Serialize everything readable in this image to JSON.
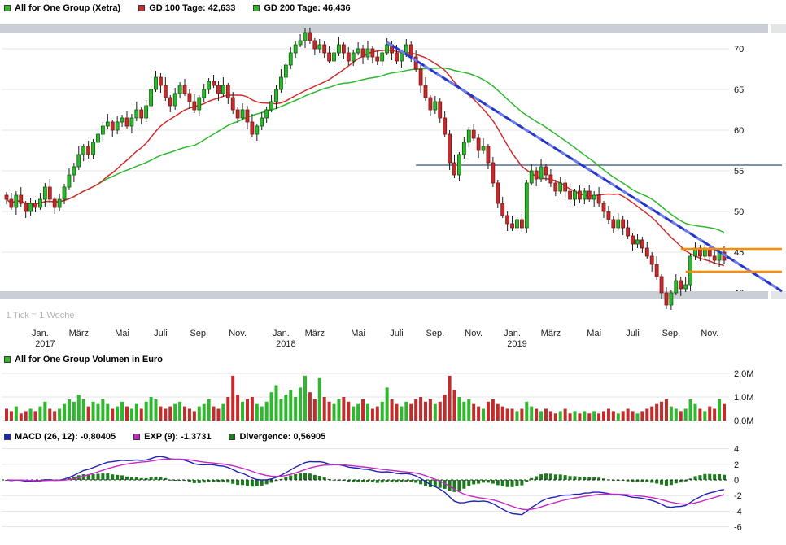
{
  "tick_note": "1 Tick = 1 Woche",
  "legends": {
    "price": [
      {
        "label": "All for One Group (Xetra)",
        "color": "#2DB82D"
      },
      {
        "label": "GD 100 Tage: 42,633",
        "color": "#CE2B2B"
      },
      {
        "label": "GD 200 Tage: 46,436",
        "color": "#2DB82D"
      }
    ],
    "volume": [
      {
        "label": "All for One Group Volumen in Euro",
        "color": "#2DB82D"
      }
    ],
    "macd": [
      {
        "label": "MACD (26, 12): -0,80405",
        "color": "#2023B8"
      },
      {
        "label": "EXP (9): -1,3731",
        "color": "#C628C6"
      },
      {
        "label": "Divergence: 0,56905",
        "color": "#1B7A1B"
      }
    ]
  },
  "chart_data": [
    {
      "type": "candlestick",
      "title": "All for One Group (Xetra)",
      "x_unit": "week",
      "tick_note": "1 Tick = 1 Woche",
      "ylim": [
        37,
        73
      ],
      "yticks": [
        40,
        45,
        50,
        55,
        60,
        65,
        70
      ],
      "xticks": [
        {
          "week": 7,
          "month": "Jan.",
          "year": "2017"
        },
        {
          "week": 15,
          "month": "März"
        },
        {
          "week": 24,
          "month": "Mai"
        },
        {
          "week": 32,
          "month": "Juli"
        },
        {
          "week": 40,
          "month": "Sep."
        },
        {
          "week": 48,
          "month": "Nov."
        },
        {
          "week": 57,
          "month": "Jan.",
          "year": "2018"
        },
        {
          "week": 64,
          "month": "März"
        },
        {
          "week": 73,
          "month": "Mai"
        },
        {
          "week": 81,
          "month": "Juli"
        },
        {
          "week": 89,
          "month": "Sep."
        },
        {
          "week": 97,
          "month": "Nov."
        },
        {
          "week": 105,
          "month": "Jan.",
          "year": "2019"
        },
        {
          "week": 113,
          "month": "März"
        },
        {
          "week": 122,
          "month": "Mai"
        },
        {
          "week": 130,
          "month": "Juli"
        },
        {
          "week": 138,
          "month": "Sep."
        },
        {
          "week": 146,
          "month": "Nov."
        }
      ],
      "colors": {
        "up": "#2DB82D",
        "down": "#C22C2C",
        "wick": "#1a1a1a"
      },
      "overlays": {
        "gd100": {
          "type": "sma",
          "window": 20,
          "color": "#CE2B2B",
          "legend_value": "42,633"
        },
        "gd200": {
          "type": "sma",
          "window": 40,
          "color": "#2DB82D",
          "legend_value": "46,436"
        },
        "trendline": {
          "from": {
            "week": 79,
            "price": 70.8
          },
          "to": {
            "week": 161,
            "price": 40.2
          },
          "color": "#2436C8",
          "dash_color": "#6E80E8"
        },
        "hlines": [
          {
            "price": 55.7,
            "from_week": 85,
            "to_week": 161,
            "color": "#7E92AC",
            "width": 2
          },
          {
            "price": 45.4,
            "from_week": 140,
            "to_week": 161,
            "color": "#FF8A00",
            "width": 2.5
          },
          {
            "price": 42.6,
            "from_week": 141,
            "to_week": 161,
            "color": "#FF8A00",
            "width": 2.5
          }
        ]
      },
      "candles": [
        [
          52.0,
          52.4,
          50.9,
          51.5
        ],
        [
          51.5,
          52.3,
          50.2,
          50.5
        ],
        [
          50.5,
          52.5,
          49.6,
          52.0
        ],
        [
          52.0,
          53.0,
          50.6,
          51.0
        ],
        [
          51.0,
          51.3,
          49.2,
          50.0
        ],
        [
          50.0,
          51.7,
          49.5,
          51.0
        ],
        [
          51.0,
          51.4,
          49.9,
          50.5
        ],
        [
          50.5,
          52.3,
          50.2,
          51.5
        ],
        [
          51.5,
          53.5,
          50.6,
          53.0
        ],
        [
          53.0,
          54.0,
          51.1,
          51.5
        ],
        [
          51.5,
          51.8,
          49.7,
          50.5
        ],
        [
          50.5,
          52.2,
          50.0,
          51.5
        ],
        [
          51.5,
          53.4,
          50.9,
          53.0
        ],
        [
          53.0,
          55.3,
          52.7,
          54.5
        ],
        [
          54.5,
          56.0,
          53.6,
          55.5
        ],
        [
          55.5,
          58.0,
          55.1,
          57.0
        ],
        [
          57.0,
          58.3,
          56.2,
          58.0
        ],
        [
          58.0,
          58.7,
          56.5,
          57.0
        ],
        [
          57.0,
          58.9,
          56.4,
          58.5
        ],
        [
          58.5,
          60.3,
          58.2,
          59.5
        ],
        [
          59.5,
          61.0,
          58.6,
          60.5
        ],
        [
          60.5,
          62.0,
          60.1,
          61.0
        ],
        [
          61.0,
          61.3,
          59.2,
          60.0
        ],
        [
          60.0,
          61.7,
          59.5,
          61.0
        ],
        [
          61.0,
          61.9,
          60.4,
          61.5
        ],
        [
          61.5,
          62.3,
          60.2,
          60.5
        ],
        [
          60.5,
          62.0,
          59.6,
          61.5
        ],
        [
          61.5,
          63.5,
          61.1,
          62.5
        ],
        [
          62.5,
          62.8,
          60.7,
          61.5
        ],
        [
          61.5,
          63.7,
          61.0,
          63.0
        ],
        [
          63.0,
          65.4,
          62.4,
          65.0
        ],
        [
          65.0,
          67.3,
          64.7,
          66.5
        ],
        [
          66.5,
          67.0,
          64.6,
          65.5
        ],
        [
          65.5,
          66.5,
          63.6,
          64.0
        ],
        [
          64.0,
          64.3,
          62.2,
          63.0
        ],
        [
          63.0,
          65.2,
          62.5,
          64.5
        ],
        [
          64.5,
          65.9,
          63.9,
          65.5
        ],
        [
          65.5,
          66.3,
          64.2,
          64.5
        ],
        [
          64.5,
          65.0,
          62.6,
          63.5
        ],
        [
          63.5,
          64.5,
          62.1,
          62.5
        ],
        [
          62.5,
          64.3,
          61.7,
          64.0
        ],
        [
          64.0,
          65.7,
          63.5,
          65.0
        ],
        [
          65.0,
          66.4,
          64.4,
          66.0
        ],
        [
          66.0,
          66.8,
          65.2,
          65.5
        ],
        [
          65.5,
          66.0,
          63.6,
          64.5
        ],
        [
          64.5,
          66.5,
          64.1,
          65.5
        ],
        [
          65.5,
          65.8,
          63.2,
          64.0
        ],
        [
          64.0,
          64.7,
          62.0,
          62.5
        ],
        [
          62.5,
          62.9,
          60.9,
          61.5
        ],
        [
          61.5,
          63.3,
          61.2,
          62.5
        ],
        [
          62.5,
          63.0,
          60.1,
          61.0
        ],
        [
          61.0,
          62.0,
          59.1,
          59.5
        ],
        [
          59.5,
          60.8,
          58.7,
          60.5
        ],
        [
          60.5,
          62.2,
          60.0,
          61.5
        ],
        [
          61.5,
          62.9,
          60.9,
          62.5
        ],
        [
          62.5,
          64.3,
          62.2,
          63.5
        ],
        [
          63.5,
          65.5,
          62.6,
          65.0
        ],
        [
          65.0,
          67.5,
          64.6,
          66.5
        ],
        [
          66.5,
          68.3,
          65.7,
          68.0
        ],
        [
          68.0,
          70.2,
          67.5,
          69.5
        ],
        [
          69.5,
          70.9,
          68.9,
          70.5
        ],
        [
          70.5,
          71.8,
          70.2,
          71.0
        ],
        [
          71.0,
          72.5,
          70.1,
          72.0
        ],
        [
          72.0,
          72.6,
          70.6,
          71.0
        ],
        [
          71.0,
          71.3,
          69.2,
          70.0
        ],
        [
          70.0,
          71.2,
          69.5,
          70.5
        ],
        [
          70.5,
          70.9,
          68.9,
          69.5
        ],
        [
          69.5,
          70.3,
          68.2,
          68.5
        ],
        [
          68.5,
          70.0,
          67.6,
          69.5
        ],
        [
          69.5,
          71.5,
          69.1,
          70.5
        ],
        [
          70.5,
          70.8,
          68.7,
          69.5
        ],
        [
          69.5,
          70.2,
          68.0,
          68.5
        ],
        [
          68.5,
          69.9,
          67.9,
          69.5
        ],
        [
          69.5,
          70.8,
          69.2,
          70.0
        ],
        [
          70.0,
          70.5,
          68.1,
          69.0
        ],
        [
          69.0,
          71.0,
          68.6,
          70.0
        ],
        [
          70.0,
          70.3,
          68.2,
          69.0
        ],
        [
          69.0,
          69.7,
          68.0,
          68.5
        ],
        [
          68.5,
          69.9,
          67.9,
          69.5
        ],
        [
          69.5,
          71.3,
          69.2,
          70.5
        ],
        [
          70.5,
          71.0,
          68.6,
          69.5
        ],
        [
          69.5,
          70.5,
          68.1,
          68.5
        ],
        [
          68.5,
          69.8,
          67.7,
          69.5
        ],
        [
          69.5,
          71.2,
          69.0,
          70.5
        ],
        [
          70.5,
          70.9,
          68.4,
          69.0
        ],
        [
          69.0,
          69.8,
          67.2,
          67.5
        ],
        [
          67.5,
          68.0,
          64.6,
          65.5
        ],
        [
          65.5,
          66.5,
          63.6,
          64.0
        ],
        [
          64.0,
          64.3,
          61.7,
          62.5
        ],
        [
          62.5,
          64.2,
          62.0,
          63.5
        ],
        [
          63.5,
          63.9,
          60.9,
          61.5
        ],
        [
          61.5,
          62.3,
          59.2,
          59.5
        ],
        [
          59.5,
          60.0,
          55.1,
          56.0
        ],
        [
          56.0,
          57.0,
          54.1,
          54.5
        ],
        [
          54.5,
          57.3,
          53.7,
          57.0
        ],
        [
          57.0,
          59.2,
          56.5,
          58.5
        ],
        [
          58.5,
          60.4,
          57.9,
          60.0
        ],
        [
          60.0,
          60.8,
          58.7,
          59.0
        ],
        [
          59.0,
          59.5,
          56.6,
          57.5
        ],
        [
          57.5,
          59.0,
          57.1,
          58.0
        ],
        [
          58.0,
          58.3,
          55.2,
          56.0
        ],
        [
          56.0,
          56.7,
          53.0,
          53.5
        ],
        [
          53.5,
          53.9,
          50.4,
          51.0
        ],
        [
          51.0,
          51.8,
          49.2,
          49.5
        ],
        [
          49.5,
          50.0,
          47.6,
          48.5
        ],
        [
          48.5,
          49.5,
          47.6,
          48.0
        ],
        [
          48.0,
          49.3,
          47.2,
          49.0
        ],
        [
          49.0,
          49.7,
          47.5,
          48.0
        ],
        [
          48.0,
          53.9,
          47.4,
          53.5
        ],
        [
          53.5,
          55.8,
          53.2,
          55.0
        ],
        [
          55.0,
          55.5,
          53.1,
          54.0
        ],
        [
          54.0,
          56.5,
          53.6,
          55.5
        ],
        [
          55.5,
          55.8,
          53.7,
          54.5
        ],
        [
          54.5,
          55.2,
          53.0,
          53.5
        ],
        [
          53.5,
          53.9,
          51.9,
          52.5
        ],
        [
          52.5,
          54.3,
          52.2,
          53.5
        ],
        [
          53.5,
          54.0,
          51.6,
          52.5
        ],
        [
          52.5,
          53.5,
          51.1,
          51.5
        ],
        [
          51.5,
          52.8,
          50.7,
          52.5
        ],
        [
          52.5,
          53.2,
          51.0,
          51.5
        ],
        [
          51.5,
          52.9,
          50.9,
          52.5
        ],
        [
          52.5,
          53.3,
          51.2,
          51.5
        ],
        [
          51.5,
          52.5,
          50.6,
          52.0
        ],
        [
          52.0,
          53.0,
          50.6,
          51.0
        ],
        [
          51.0,
          51.3,
          49.2,
          50.0
        ],
        [
          50.0,
          50.7,
          48.5,
          49.0
        ],
        [
          49.0,
          49.4,
          47.4,
          48.0
        ],
        [
          48.0,
          49.8,
          47.7,
          49.0
        ],
        [
          49.0,
          49.5,
          47.1,
          48.0
        ],
        [
          48.0,
          49.0,
          46.6,
          47.0
        ],
        [
          47.0,
          47.3,
          45.2,
          46.0
        ],
        [
          46.0,
          47.2,
          45.5,
          46.5
        ],
        [
          46.5,
          46.9,
          44.9,
          45.5
        ],
        [
          45.5,
          46.3,
          44.2,
          44.5
        ],
        [
          44.5,
          45.0,
          42.6,
          43.5
        ],
        [
          43.5,
          44.5,
          41.6,
          42.0
        ],
        [
          42.0,
          42.3,
          39.2,
          40.0
        ],
        [
          40.0,
          40.7,
          38.0,
          38.5
        ],
        [
          38.5,
          40.4,
          37.9,
          40.0
        ],
        [
          40.0,
          42.3,
          39.7,
          41.5
        ],
        [
          41.5,
          42.0,
          39.6,
          40.5
        ],
        [
          40.5,
          42.0,
          40.1,
          41.0
        ],
        [
          41.0,
          44.8,
          40.2,
          44.5
        ],
        [
          44.5,
          46.2,
          44.0,
          45.5
        ],
        [
          45.5,
          45.9,
          43.9,
          44.5
        ],
        [
          44.5,
          46.3,
          44.2,
          45.5
        ],
        [
          45.5,
          46.0,
          43.6,
          44.5
        ],
        [
          44.5,
          45.5,
          43.6,
          44.0
        ],
        [
          44.0,
          45.3,
          43.2,
          45.0
        ],
        [
          45.0,
          45.7,
          43.5,
          44.0
        ]
      ]
    },
    {
      "type": "bar",
      "title": "All for One Group Volumen in Euro",
      "unit": "M EUR",
      "yticks": [
        {
          "value": 0,
          "label": "0,0M"
        },
        {
          "value": 1,
          "label": "1,0M"
        },
        {
          "value": 2,
          "label": "2,0M"
        }
      ],
      "colors": {
        "up": "#2DB82D",
        "down": "#C22C2C"
      },
      "values_meur": [
        0.5,
        0.4,
        0.6,
        0.3,
        0.4,
        0.5,
        0.4,
        0.6,
        0.8,
        0.5,
        0.4,
        0.5,
        0.7,
        0.9,
        0.8,
        1.1,
        0.9,
        0.6,
        0.8,
        0.7,
        0.9,
        0.7,
        0.5,
        0.6,
        0.8,
        0.6,
        0.5,
        0.7,
        0.5,
        0.8,
        1.0,
        0.9,
        0.6,
        0.5,
        0.6,
        0.7,
        0.8,
        0.6,
        0.5,
        0.4,
        0.6,
        0.7,
        0.9,
        0.6,
        0.5,
        0.7,
        1.0,
        1.9,
        1.1,
        0.8,
        0.9,
        1.0,
        0.7,
        0.6,
        0.8,
        1.2,
        1.5,
        0.9,
        1.1,
        1.3,
        1.0,
        1.4,
        1.9,
        1.2,
        0.9,
        1.8,
        1.0,
        0.8,
        0.7,
        0.9,
        1.0,
        0.8,
        0.6,
        0.7,
        0.9,
        0.7,
        0.5,
        0.6,
        0.8,
        1.4,
        0.9,
        0.7,
        0.6,
        0.8,
        0.7,
        0.9,
        1.0,
        0.8,
        0.9,
        0.7,
        0.8,
        1.1,
        1.9,
        1.3,
        1.0,
        0.8,
        0.9,
        0.7,
        0.6,
        0.5,
        0.8,
        0.9,
        0.7,
        0.6,
        0.5,
        0.5,
        0.4,
        0.5,
        0.8,
        0.6,
        0.5,
        0.4,
        0.5,
        0.4,
        0.3,
        0.4,
        0.5,
        0.3,
        0.4,
        0.3,
        0.4,
        0.3,
        0.4,
        0.3,
        0.4,
        0.5,
        0.4,
        0.3,
        0.4,
        0.5,
        0.4,
        0.3,
        0.4,
        0.5,
        0.6,
        0.7,
        0.8,
        0.9,
        0.6,
        0.5,
        0.4,
        0.5,
        0.9,
        0.7,
        0.5,
        0.4,
        0.6,
        0.5,
        0.9,
        0.7
      ]
    },
    {
      "type": "line",
      "title": "MACD",
      "params": {
        "fast": 12,
        "slow": 26,
        "signal": 9
      },
      "derived_from": "closes of chart_data[0].candles: MACD = EMA12 - EMA26, EXP = EMA9(MACD), Divergence = MACD - EXP",
      "current": {
        "macd": "-0,80405",
        "exp": "-1,3731",
        "divergence": "0,56905"
      },
      "yticks": [
        4,
        2,
        0,
        -2,
        -4,
        -6
      ],
      "colors": {
        "macd": "#2023B8",
        "signal": "#C628C6",
        "hist": "#1B7A1B"
      }
    }
  ]
}
